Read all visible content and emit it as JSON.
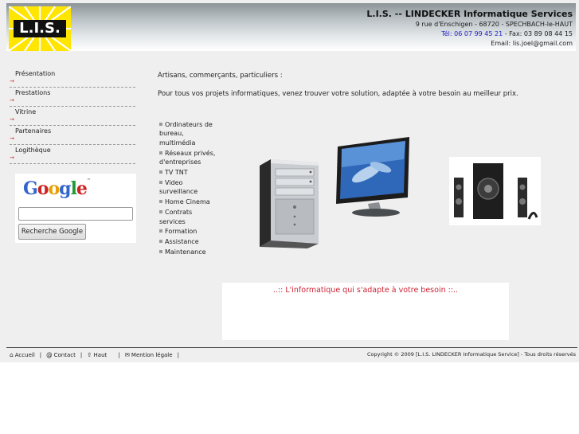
{
  "header": {
    "logo_text": "L.I.S.",
    "company_name": "L.I.S. -- LINDECKER Informatique Services",
    "address": "9 rue d'Enschigen - 68720 - SPECHBACH-le-HAUT",
    "tel_label": "Tél:",
    "tel_value": "06 07 99 45 21",
    "fax": "- Fax: 03 89 08 44 15",
    "email": "Email: lis.joel@gmail.com"
  },
  "sidebar": {
    "items": [
      {
        "label": "Présentation"
      },
      {
        "label": "Prestations"
      },
      {
        "label": "Vitrine"
      },
      {
        "label": "Partenaires"
      },
      {
        "label": "Logithèque"
      }
    ],
    "arrow_glyph": "→"
  },
  "google": {
    "logo": "Google",
    "tm": "™",
    "search_value": "",
    "button_label": "Recherche Google"
  },
  "main": {
    "intro1": "Artisans, commerçants, particuliers :",
    "intro2": "Pour tous vos projets informatiques, venez trouver votre solution, adaptée à votre besoin au meilleur prix.",
    "services": [
      "Ordinateurs de bureau, multimédia",
      "Réseaux privés, d'entreprises",
      "TV TNT",
      "Video surveillance",
      "Home Cinema",
      "Contrats services",
      "Formation",
      "Assistance",
      "Maintenance"
    ],
    "slogan": "..:: L'informatique qui s'adapte à votre besoin ::.."
  },
  "footer": {
    "links": [
      {
        "icon": "home-icon",
        "glyph": "⌂",
        "label": "Accueil"
      },
      {
        "icon": "at-icon",
        "glyph": "@",
        "label": "Contact"
      },
      {
        "icon": "up-icon",
        "glyph": "⇧",
        "label": "Haut"
      },
      {
        "icon": "legal-icon",
        "glyph": "✉",
        "label": "Mention légale"
      }
    ],
    "copyright": "Copyright © 2009 [L.I.S. LINDECKER Informatique Service] - Tous droits réservés"
  },
  "colors": {
    "accent_red": "#cc2233",
    "phone_blue": "#2222cc",
    "logo_yellow": "#ffe500",
    "page_bg": "#efefef"
  }
}
